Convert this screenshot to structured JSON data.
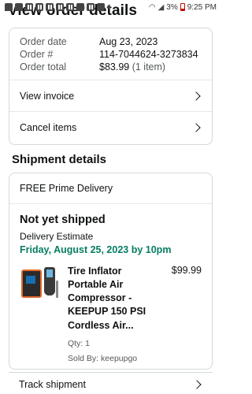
{
  "status_bar": {
    "battery": "3%",
    "time": "9:25 PM"
  },
  "header": {
    "title": "View order details"
  },
  "order_info": {
    "rows": [
      {
        "label": "Order date",
        "value": "Aug 23, 2023"
      },
      {
        "label": "Order #",
        "value": "114-7044624-3273834"
      },
      {
        "label": "Order total",
        "value": "$83.99",
        "extra": "(1 item)"
      }
    ]
  },
  "order_actions": {
    "view_invoice": "View invoice",
    "cancel_items": "Cancel items"
  },
  "shipment": {
    "section_title": "Shipment details",
    "delivery_type": "FREE Prime Delivery",
    "status": "Not yet shipped",
    "estimate_label": "Delivery Estimate",
    "estimate_date": "Friday, August 25, 2023 by 10pm",
    "item": {
      "title": "Tire Inflator Portable Air Compressor - KEEPUP 150 PSI Cordless Air...",
      "price": "$99.99",
      "qty": "Qty: 1",
      "seller": "Sold By: keepupgo"
    },
    "track_label": "Track shipment"
  },
  "icons": {
    "chevron": "chevron-right-icon"
  },
  "colors": {
    "delivery_date": "#067d62",
    "border": "#d5d9d9"
  }
}
